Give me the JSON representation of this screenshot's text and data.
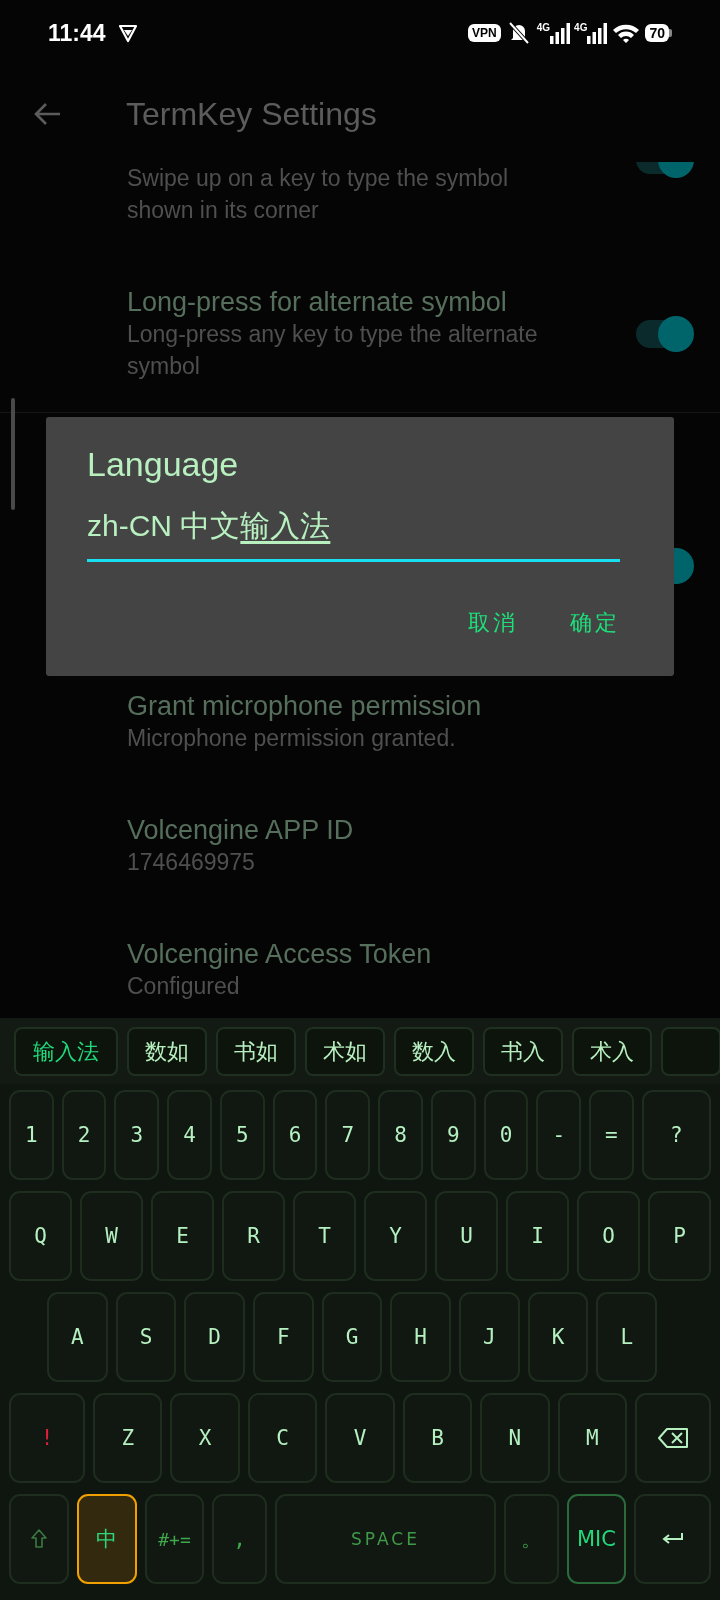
{
  "status_bar": {
    "time": "11:44",
    "vpn": "VPN",
    "networks": [
      "4G",
      "4G"
    ],
    "battery": "70"
  },
  "app_bar": {
    "title": "TermKey Settings"
  },
  "settings": [
    {
      "kind": "switch-partial",
      "subtitle": "Swipe up on a key to type the symbol shown in its corner",
      "on": true
    },
    {
      "kind": "switch",
      "title": "Long-press for alternate symbol",
      "subtitle": "Long-press any key to type the alternate symbol",
      "on": true
    },
    {
      "kind": "switch-covered",
      "on": true
    },
    {
      "kind": "info",
      "title": "Grant microphone permission",
      "subtitle": "Microphone permission granted."
    },
    {
      "kind": "info",
      "title": "Volcengine APP ID",
      "subtitle": "1746469975"
    },
    {
      "kind": "info",
      "title": "Volcengine Access Token",
      "subtitle": "Configured"
    }
  ],
  "dialog": {
    "title": "Language",
    "value": "zh-CN 中文",
    "composing": "输入法",
    "buttons": [
      "取消",
      "确定"
    ]
  },
  "keyboard": {
    "candidates": [
      {
        "text": "输入法",
        "selected": true
      },
      {
        "text": "数如",
        "selected": false
      },
      {
        "text": "书如",
        "selected": false
      },
      {
        "text": "术如",
        "selected": false
      },
      {
        "text": "数入",
        "selected": false
      },
      {
        "text": "书入",
        "selected": false
      },
      {
        "text": "术入",
        "selected": false
      },
      {
        "kind": "cut"
      }
    ],
    "rows": [
      {
        "keys": [
          {
            "kind": "char",
            "label": "1"
          },
          {
            "kind": "char",
            "label": "2"
          },
          {
            "kind": "char",
            "label": "3"
          },
          {
            "kind": "char",
            "label": "4"
          },
          {
            "kind": "char",
            "label": "5"
          },
          {
            "kind": "char",
            "label": "6"
          },
          {
            "kind": "char",
            "label": "7"
          },
          {
            "kind": "char",
            "label": "8"
          },
          {
            "kind": "char",
            "label": "9"
          },
          {
            "kind": "char",
            "label": "0"
          },
          {
            "kind": "char",
            "label": "-"
          },
          {
            "kind": "char",
            "label": "="
          },
          {
            "kind": "wide",
            "label": "?"
          }
        ]
      },
      {
        "keys": [
          {
            "kind": "char",
            "label": "Q"
          },
          {
            "kind": "char",
            "label": "W"
          },
          {
            "kind": "char",
            "label": "E"
          },
          {
            "kind": "char",
            "label": "R"
          },
          {
            "kind": "char",
            "label": "T"
          },
          {
            "kind": "char",
            "label": "Y"
          },
          {
            "kind": "char",
            "label": "U"
          },
          {
            "kind": "char",
            "label": "I"
          },
          {
            "kind": "char",
            "label": "O"
          },
          {
            "kind": "char",
            "label": "P"
          }
        ]
      },
      {
        "keys": [
          {
            "kind": "char",
            "label": "A"
          },
          {
            "kind": "char",
            "label": "S"
          },
          {
            "kind": "char",
            "label": "D"
          },
          {
            "kind": "char",
            "label": "F"
          },
          {
            "kind": "char",
            "label": "G"
          },
          {
            "kind": "char",
            "label": "H"
          },
          {
            "kind": "char",
            "label": "J"
          },
          {
            "kind": "char",
            "label": "K"
          },
          {
            "kind": "char",
            "label": "L"
          }
        ]
      },
      {
        "keys": [
          {
            "kind": "alert",
            "label": "!"
          },
          {
            "kind": "char",
            "label": "Z"
          },
          {
            "kind": "char",
            "label": "X"
          },
          {
            "kind": "char",
            "label": "C"
          },
          {
            "kind": "char",
            "label": "V"
          },
          {
            "kind": "char",
            "label": "B"
          },
          {
            "kind": "char",
            "label": "N"
          },
          {
            "kind": "char",
            "label": "M"
          },
          {
            "kind": "backspace"
          }
        ]
      },
      {
        "keys": [
          {
            "kind": "shift"
          },
          {
            "kind": "ime",
            "label": "中",
            "on": true
          },
          {
            "kind": "symbols",
            "label": "#+="
          },
          {
            "kind": "punct",
            "label": ","
          },
          {
            "kind": "space",
            "label": "SPACE"
          },
          {
            "kind": "punct",
            "label": "。"
          },
          {
            "kind": "mic",
            "label": "MIC"
          },
          {
            "kind": "enter"
          }
        ]
      }
    ]
  }
}
